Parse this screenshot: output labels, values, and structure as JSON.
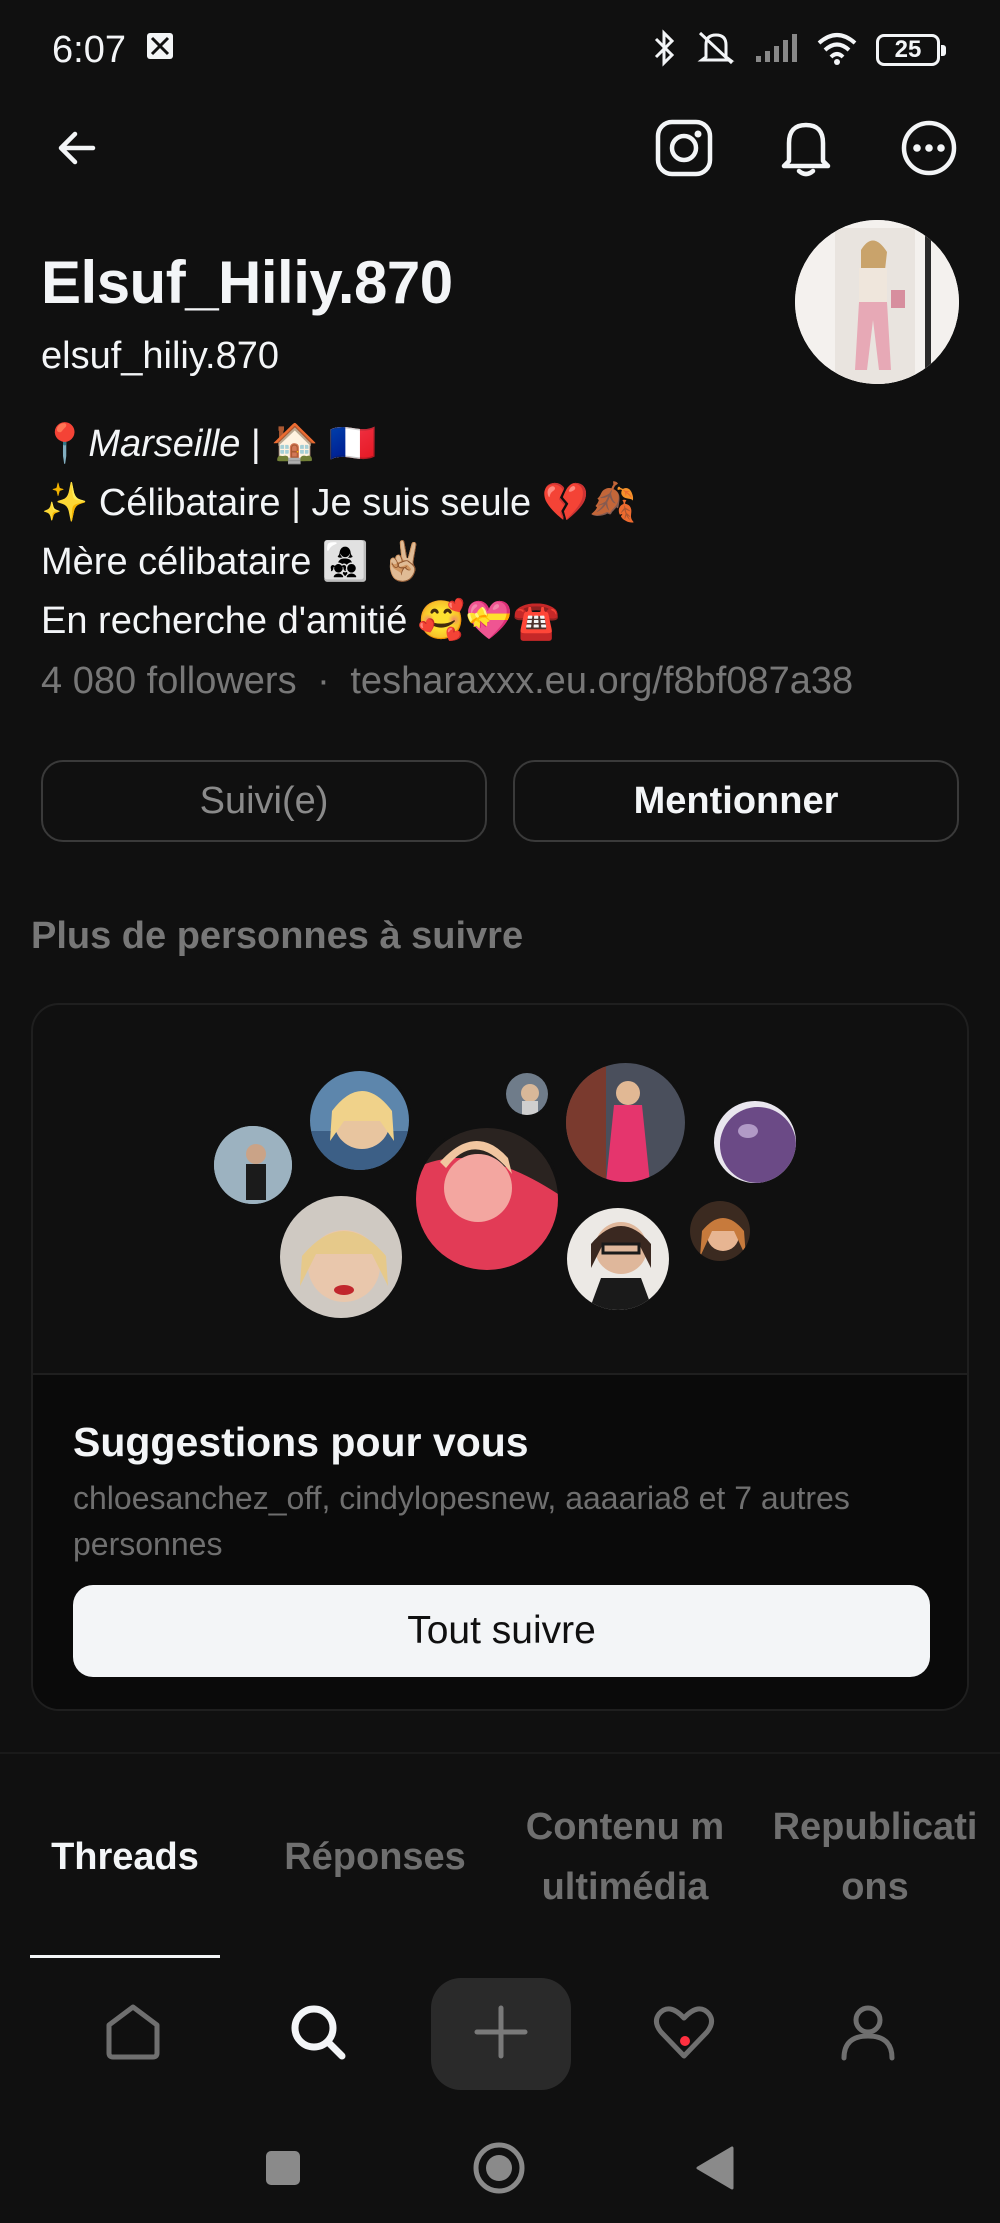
{
  "status_bar": {
    "time": "6:07",
    "battery": "25"
  },
  "profile": {
    "display_name": "Elsuf_Hiliy.870",
    "username": "elsuf_hiliy.870",
    "bio": [
      "📍Marseille | 🏠 🇫🇷",
      "✨ Célibataire | Je suis seule 💔🍂",
      "Mère célibataire 👩‍👧‍👦 ✌🏼",
      "En recherche d'amitié 🥰💝☎️"
    ],
    "followers": "4 080 followers",
    "separator": "·",
    "link": "tesharaxxx.eu.org/f8bf087a38"
  },
  "actions": {
    "followed_label": "Suivi(e)",
    "mention_label": "Mentionner"
  },
  "suggestions": {
    "section_title": "Plus de personnes à suivre",
    "title": "Suggestions pour vous",
    "names": "chloesanchez_off, cindylopesnew, aaaaria8 et 7 autres personnes",
    "follow_all_label": "Tout suivre"
  },
  "tabs": [
    {
      "label": "Threads"
    },
    {
      "label": "Réponses"
    },
    {
      "label": "Contenu multimédia"
    },
    {
      "label": "Republications"
    }
  ],
  "icons": {
    "back": "arrow-left-icon",
    "instagram": "instagram-icon",
    "bell": "bell-icon",
    "more": "more-icon",
    "home": "home-icon",
    "search": "search-icon",
    "plus": "plus-icon",
    "heart": "heart-icon",
    "profile": "person-icon"
  },
  "colors": {
    "background": "#101010",
    "text": "#f3f5f7",
    "muted": "#777777",
    "notification": "#ff3040"
  }
}
